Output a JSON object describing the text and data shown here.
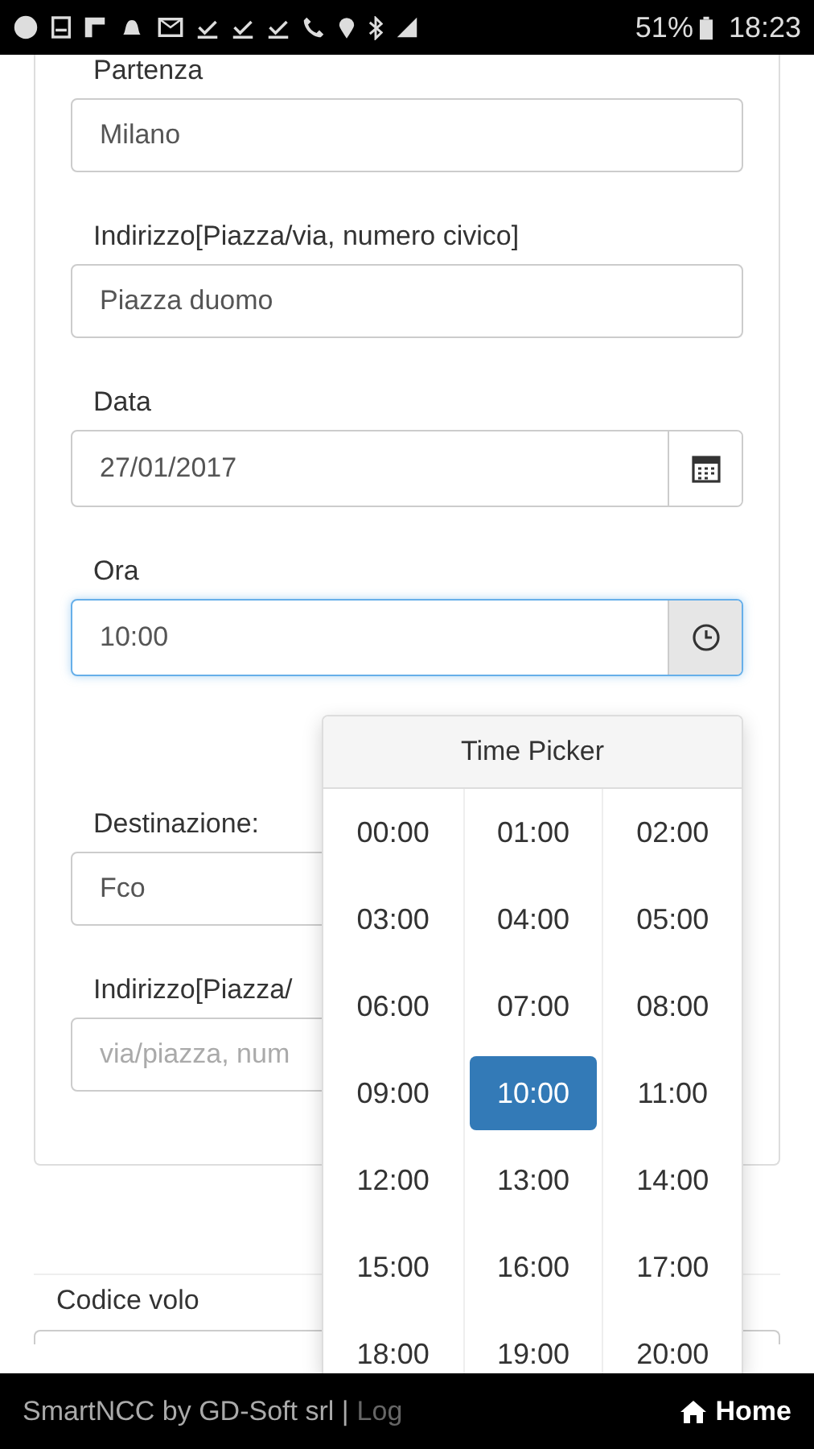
{
  "status_bar": {
    "battery": "51%",
    "time": "18:23"
  },
  "form": {
    "sections": [
      {
        "fields": [
          {
            "label": "Partenza",
            "value": "Milano",
            "kind": "text",
            "focused": false
          },
          {
            "label": "Indirizzo[Piazza/via, numero civico]",
            "value": "Piazza duomo",
            "kind": "text",
            "focused": false
          },
          {
            "label": "Data",
            "value": "27/01/2017",
            "kind": "date",
            "focused": false
          },
          {
            "label": "Ora",
            "value": "10:00",
            "kind": "time",
            "focused": true
          }
        ]
      },
      {
        "fields": [
          {
            "label": "Destinazione:",
            "value": "Fco",
            "kind": "text",
            "focused": false
          },
          {
            "label": "Indirizzo[Piazza/",
            "placeholder": "via/piazza, num",
            "kind": "text",
            "focused": false
          }
        ]
      }
    ]
  },
  "flight": {
    "label": "Codice volo"
  },
  "time_picker": {
    "title": "Time Picker",
    "hours": [
      {
        "label": "00:00",
        "selected": false
      },
      {
        "label": "01:00",
        "selected": false
      },
      {
        "label": "02:00",
        "selected": false
      },
      {
        "label": "03:00",
        "selected": false
      },
      {
        "label": "04:00",
        "selected": false
      },
      {
        "label": "05:00",
        "selected": false
      },
      {
        "label": "06:00",
        "selected": false
      },
      {
        "label": "07:00",
        "selected": false
      },
      {
        "label": "08:00",
        "selected": false
      },
      {
        "label": "09:00",
        "selected": false
      },
      {
        "label": "10:00",
        "selected": true
      },
      {
        "label": "11:00",
        "selected": false
      },
      {
        "label": "12:00",
        "selected": false
      },
      {
        "label": "13:00",
        "selected": false
      },
      {
        "label": "14:00",
        "selected": false
      },
      {
        "label": "15:00",
        "selected": false
      },
      {
        "label": "16:00",
        "selected": false
      },
      {
        "label": "17:00",
        "selected": false
      },
      {
        "label": "18:00",
        "selected": false
      },
      {
        "label": "19:00",
        "selected": false
      },
      {
        "label": "20:00",
        "selected": false
      }
    ]
  },
  "footer": {
    "credit": "SmartNCC by GD-Soft srl |",
    "link": "Log",
    "home": "Home"
  }
}
